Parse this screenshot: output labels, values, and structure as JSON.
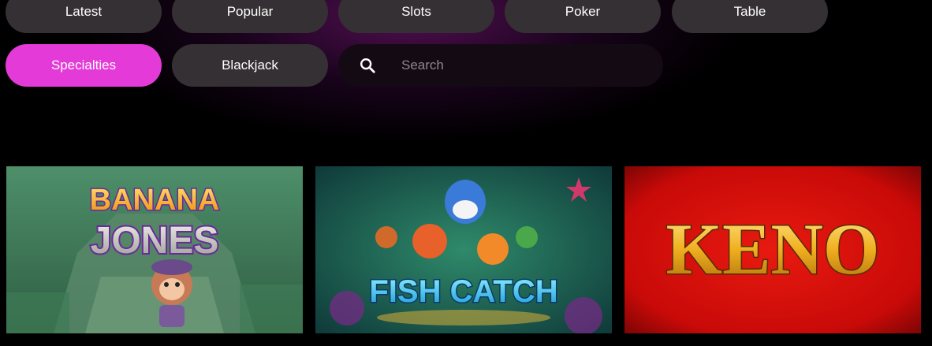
{
  "categories": {
    "latest": "Latest",
    "popular": "Popular",
    "slots": "Slots",
    "poker": "Poker",
    "table": "Table",
    "specialties": "Specialties",
    "blackjack": "Blackjack"
  },
  "active_category": "Specialties",
  "search": {
    "placeholder": "Search",
    "value": ""
  },
  "games": [
    {
      "title_line1": "BANANA",
      "title_line2": "JONES"
    },
    {
      "title": "FISH CATCH"
    },
    {
      "title": "KENO"
    }
  ],
  "colors": {
    "active_pill": "#e43ad8",
    "pill": "#353033",
    "background": "#000000",
    "keno_red": "#d01010",
    "keno_gold": "#f0b020"
  }
}
